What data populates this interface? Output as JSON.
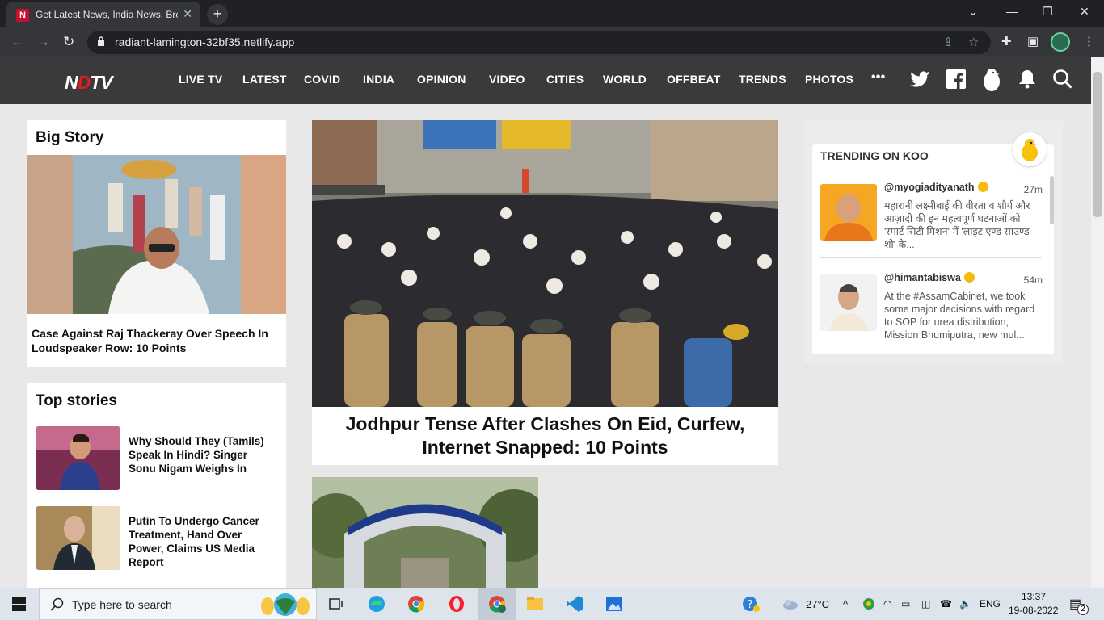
{
  "browser": {
    "tab_title": "Get Latest News, India News, Bre",
    "tab_favicon": "N",
    "url": "radiant-lamington-32bf35.netlify.app"
  },
  "site": {
    "logo_main": "N",
    "logo_dot": "D",
    "logo_rest": "TV",
    "nav": [
      "LIVE TV",
      "LATEST",
      "COVID",
      "INDIA",
      "OPINION",
      "VIDEO",
      "CITIES",
      "WORLD",
      "OFFBEAT",
      "TRENDS",
      "PHOTOS"
    ],
    "more": "•••"
  },
  "big_story": {
    "heading": "Big Story",
    "headline": "Case Against Raj Thackeray Over Speech In Loudspeaker Row: 10 Points"
  },
  "top_stories": {
    "heading": "Top stories",
    "items": [
      {
        "title": "Why Should They (Tamils) Speak In Hindi? Singer Sonu Nigam Weighs In"
      },
      {
        "title": "Putin To Undergo Cancer Treatment, Hand Over Power, Claims US Media Report"
      }
    ]
  },
  "main_story": {
    "headline": "Jodhpur Tense After Clashes On Eid, Curfew, Internet Snapped: 10 Points"
  },
  "koo": {
    "title": "TRENDING ON KOO",
    "posts": [
      {
        "handle": "@myogiadityanath",
        "time": "27m",
        "text": "महारानी लक्ष्मीबाई की वीरता व शौर्य और आज़ादी की इन महत्वपूर्ण घटनाओं को 'स्मार्ट सिटी मिशन' में 'लाइट एण्ड साउण्ड शो' के..."
      },
      {
        "handle": "@himantabiswa",
        "time": "54m",
        "text": "At the #AssamCabinet, we took some major decisions with regard to SOP for urea distribution, Mission Bhumiputra, new mul..."
      }
    ]
  },
  "taskbar": {
    "search_placeholder": "Type here to search",
    "weather": "27°C",
    "lang": "ENG",
    "time": "13:37",
    "date": "19-08-2022",
    "notif_count": "2"
  }
}
